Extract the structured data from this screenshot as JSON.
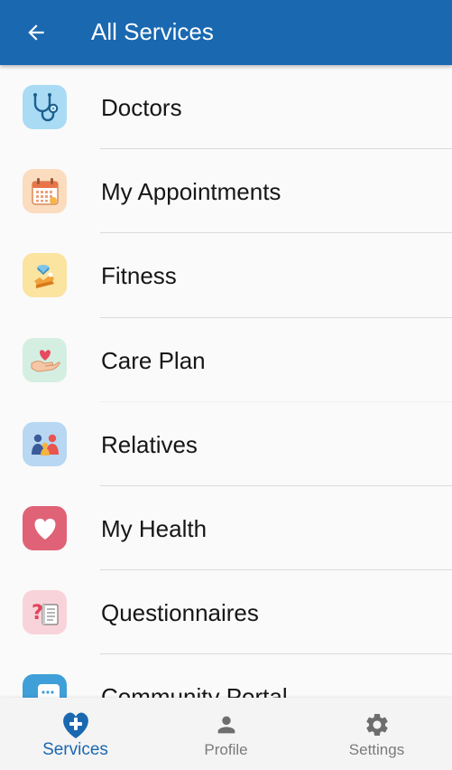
{
  "app_bar": {
    "title": "All Services",
    "back_icon": "arrow-left-icon",
    "background": "#1a68b0"
  },
  "services": [
    {
      "label": "Doctors",
      "icon": "stethoscope-icon",
      "icon_bg": "#a9dbf4"
    },
    {
      "label": "My Appointments",
      "icon": "calendar-icon",
      "icon_bg": "#fbdcbf"
    },
    {
      "label": "Fitness",
      "icon": "fitness-icon",
      "icon_bg": "#fbe3a0"
    },
    {
      "label": "Care Plan",
      "icon": "care-plan-icon",
      "icon_bg": "#d4efe2"
    },
    {
      "label": "Relatives",
      "icon": "relatives-icon",
      "icon_bg": "#b7d7f2"
    },
    {
      "label": "My Health",
      "icon": "heart-icon",
      "icon_bg": "#e06276"
    },
    {
      "label": "Questionnaires",
      "icon": "questionnaire-icon",
      "icon_bg": "#f8d4da"
    },
    {
      "label": "Community Portal",
      "icon": "chat-icon",
      "icon_bg": "#3f9fd8"
    }
  ],
  "bottom_nav": {
    "items": [
      {
        "label": "Services",
        "icon": "services-heart-icon",
        "active": true
      },
      {
        "label": "Profile",
        "icon": "person-icon",
        "active": false
      },
      {
        "label": "Settings",
        "icon": "gear-icon",
        "active": false
      }
    ],
    "active_color": "#1a68b0",
    "inactive_color": "#7a7a7a"
  }
}
